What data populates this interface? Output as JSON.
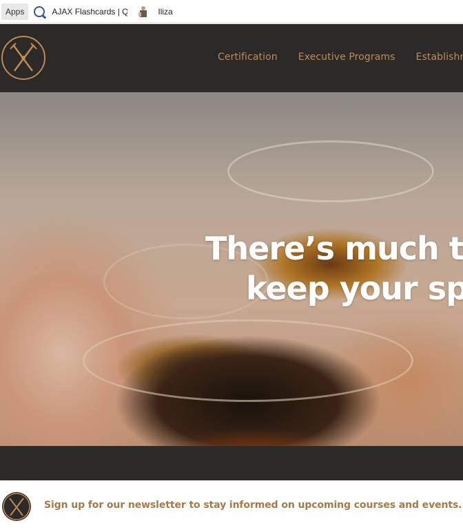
{
  "bookmarks": {
    "apps_label": "Apps",
    "ajax_label": "AJAX Flashcards | Qu",
    "iliza_label": "Iliza",
    "ajax_icon": "quizlet-q-icon",
    "iliza_icon": "person-favicon"
  },
  "header": {
    "logo_icon": "crossed-swords-circle-logo",
    "nav": [
      {
        "label": "Certification"
      },
      {
        "label": "Executive Programs"
      },
      {
        "label": "Establishm"
      }
    ],
    "colors": {
      "background": "#2c2a29",
      "accent": "#c08a53"
    }
  },
  "hero": {
    "line1": "There’s much to",
    "line2": "keep your spi",
    "background": "close-up photo of whisky glasses"
  },
  "newsletter": {
    "text": "Sign up for our newsletter to stay informed on upcoming courses and events.",
    "color": "#a87947"
  }
}
